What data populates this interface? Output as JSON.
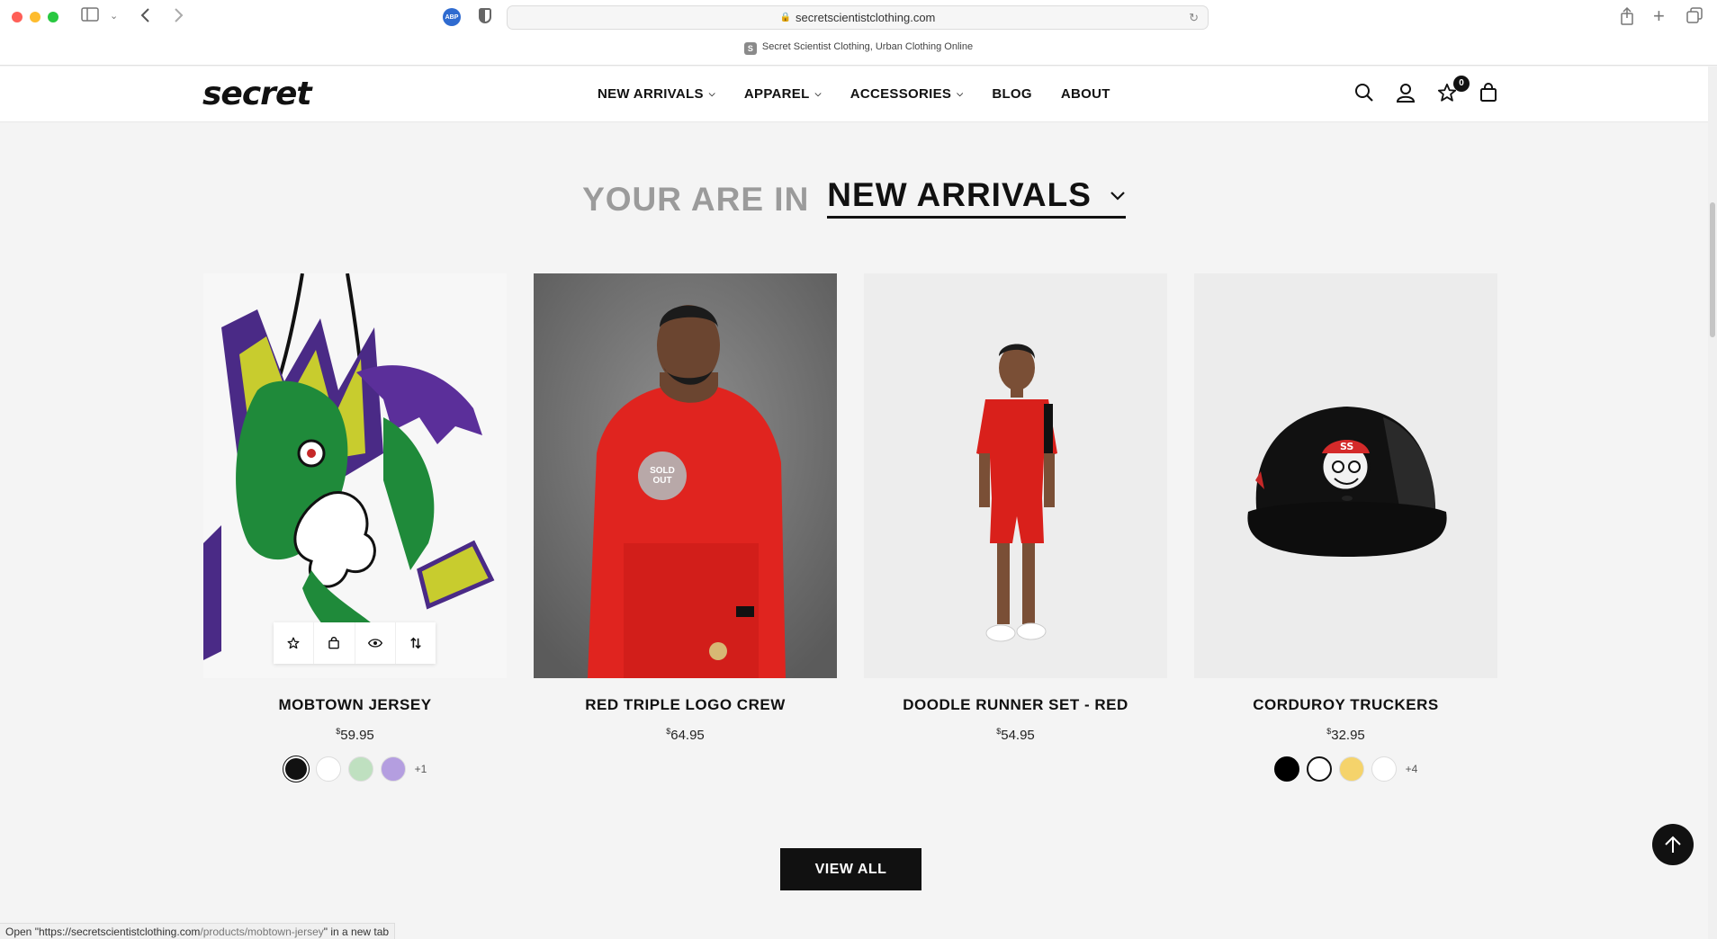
{
  "browser": {
    "url": "secretscientistclothing.com",
    "tab_title": "Secret Scientist Clothing, Urban Clothing Online",
    "tab_favicon": "S",
    "abp_label": "ABP",
    "status_url_prefix": "Open \"https://secretscientistclothing.com",
    "status_url_path": "/products/mobtown-jersey",
    "status_url_suffix": "\" in a new tab"
  },
  "header": {
    "logo": "secret",
    "nav": [
      {
        "label": "NEW ARRIVALS",
        "has_dropdown": true
      },
      {
        "label": "APPAREL",
        "has_dropdown": true
      },
      {
        "label": "ACCESSORIES",
        "has_dropdown": true
      },
      {
        "label": "BLOG",
        "has_dropdown": false
      },
      {
        "label": "ABOUT",
        "has_dropdown": false
      }
    ],
    "wishlist_count": "0",
    "icons": [
      "search-icon",
      "account-icon",
      "wishlist-star-icon",
      "cart-bag-icon"
    ]
  },
  "section": {
    "prefix": "YOUR ARE IN",
    "selected": "NEW ARRIVALS"
  },
  "products": [
    {
      "name": "MOBTOWN JERSEY",
      "price_symbol": "$",
      "price": "59.95",
      "swatches": [
        "#111111",
        "#ffffff",
        "#bfe0c0",
        "#b49ee0"
      ],
      "more": "+1",
      "image": "jersey-graphic"
    },
    {
      "name": "RED TRIPLE LOGO CREW",
      "price_symbol": "$",
      "price": "64.95",
      "swatches": [],
      "more": "",
      "badge": "SOLD OUT",
      "image": "man-red-crewneck"
    },
    {
      "name": "DOODLE RUNNER SET - RED",
      "price_symbol": "$",
      "price": "54.95",
      "swatches": [],
      "more": "",
      "image": "kid-red-set"
    },
    {
      "name": "CORDUROY TRUCKERS",
      "price_symbol": "$",
      "price": "32.95",
      "swatches": [
        "#000000",
        "#ffffff",
        "#f5d36b",
        "#ffffff"
      ],
      "more": "+4",
      "image": "black-trucker-cap"
    }
  ],
  "sold_out_badge": {
    "line1": "SOLD",
    "line2": "OUT"
  },
  "quick_actions": [
    "wishlist-star-icon",
    "add-to-cart-bag-icon",
    "quick-view-eye-icon",
    "compare-arrows-icon"
  ],
  "view_all_label": "VIEW ALL",
  "colors": {
    "accent": "#111111",
    "muted_title": "#9b9b9b",
    "page_bg": "#f4f4f4"
  }
}
